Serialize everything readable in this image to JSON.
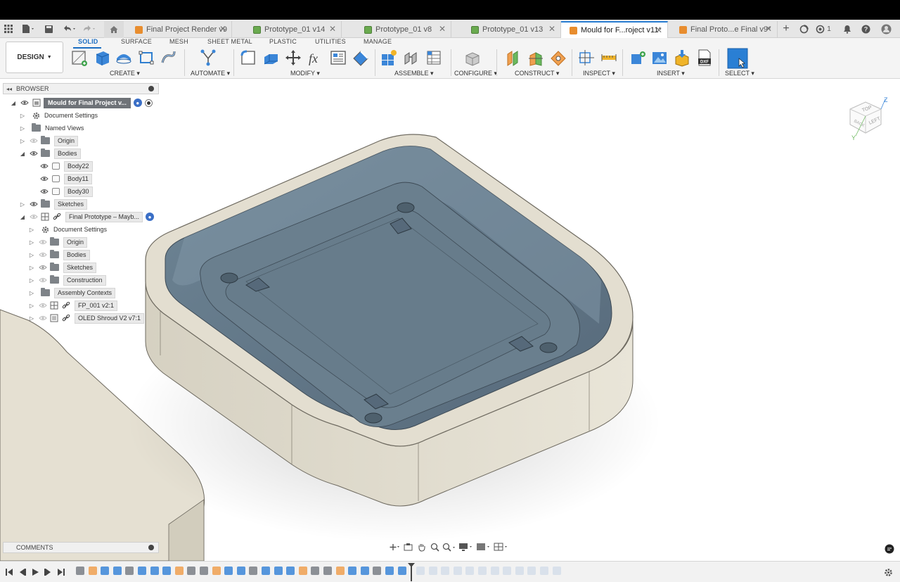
{
  "tabs": [
    {
      "label": "Final Project Render v9",
      "icon": "orange",
      "active": false
    },
    {
      "label": "Prototype_01 v14",
      "icon": "green",
      "active": false
    },
    {
      "label": "Prototype_01 v8",
      "icon": "green",
      "active": false
    },
    {
      "label": "Prototype_01 v13",
      "icon": "green",
      "active": false
    },
    {
      "label": "Mould for F...roject v11*",
      "icon": "orange",
      "active": true
    },
    {
      "label": "Final Proto...e Final v9*",
      "icon": "orange",
      "active": false
    }
  ],
  "tabstrip_right": {
    "job_count": "1"
  },
  "workspace": {
    "label": "DESIGN"
  },
  "workspace_tabs": [
    "SOLID",
    "SURFACE",
    "MESH",
    "SHEET METAL",
    "PLASTIC",
    "UTILITIES",
    "MANAGE"
  ],
  "tool_groups": [
    "CREATE",
    "AUTOMATE",
    "MODIFY",
    "ASSEMBLE",
    "CONFIGURE",
    "CONSTRUCT",
    "INSPECT",
    "INSERT",
    "SELECT"
  ],
  "browser": {
    "title": "BROWSER",
    "root": "Mould for Final Project v...",
    "items": [
      {
        "label": "Document Settings"
      },
      {
        "label": "Named Views"
      },
      {
        "label": "Origin"
      },
      {
        "label": "Bodies"
      },
      {
        "label": "Body22"
      },
      {
        "label": "Body11"
      },
      {
        "label": "Body30"
      },
      {
        "label": "Sketches"
      },
      {
        "label": "Final Prototype – Mayb..."
      },
      {
        "label": "Document Settings"
      },
      {
        "label": "Origin"
      },
      {
        "label": "Bodies"
      },
      {
        "label": "Sketches"
      },
      {
        "label": "Construction"
      },
      {
        "label": "Assembly Contexts"
      },
      {
        "label": "FP_001 v2:1"
      },
      {
        "label": "OLED Shroud V2 v7:1"
      }
    ]
  },
  "comments": {
    "title": "COMMENTS"
  },
  "viewcube": {
    "faces": [
      "TOP",
      "LEFT",
      "BACK"
    ],
    "axes": [
      "Z",
      "Y"
    ]
  },
  "colors": {
    "accent": "#1b6ec2",
    "mould_shell": "#e2ddcf",
    "cavity": "#5f7483"
  }
}
